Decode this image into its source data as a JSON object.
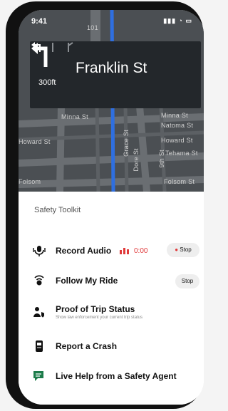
{
  "status_bar": {
    "time": "9:41",
    "icons_text": "▮▮▮ ◔ ▭"
  },
  "map": {
    "street_labels": [
      "Minna St",
      "Minna St",
      "Natoma St",
      "Howard St",
      "Tehama St",
      "Howard St",
      "Folsom",
      "Folsom St",
      "Grace St",
      "Dore St",
      "9th St",
      "101"
    ]
  },
  "navigation": {
    "distance": "300ft",
    "street": "Franklin St"
  },
  "safety_toolkit": {
    "title": "Safety Toolkit",
    "items": [
      {
        "label": "Record Audio",
        "icon": "microphone-icon",
        "recording_time": "0:00",
        "button": "Stop"
      },
      {
        "label": "Follow My Ride",
        "icon": "location-share-icon",
        "button": "Stop"
      },
      {
        "label": "Proof of Trip Status",
        "icon": "person-shield-icon",
        "subtitle": "Show law enforcement your current trip status"
      },
      {
        "label": "Report a Crash",
        "icon": "phone-report-icon"
      },
      {
        "label": "Live Help from a Safety Agent",
        "icon": "chat-agent-icon"
      }
    ]
  },
  "colors": {
    "accent_green": "#1c7c4a",
    "record_red": "#e0393a",
    "map_route": "#2f6fe0"
  }
}
